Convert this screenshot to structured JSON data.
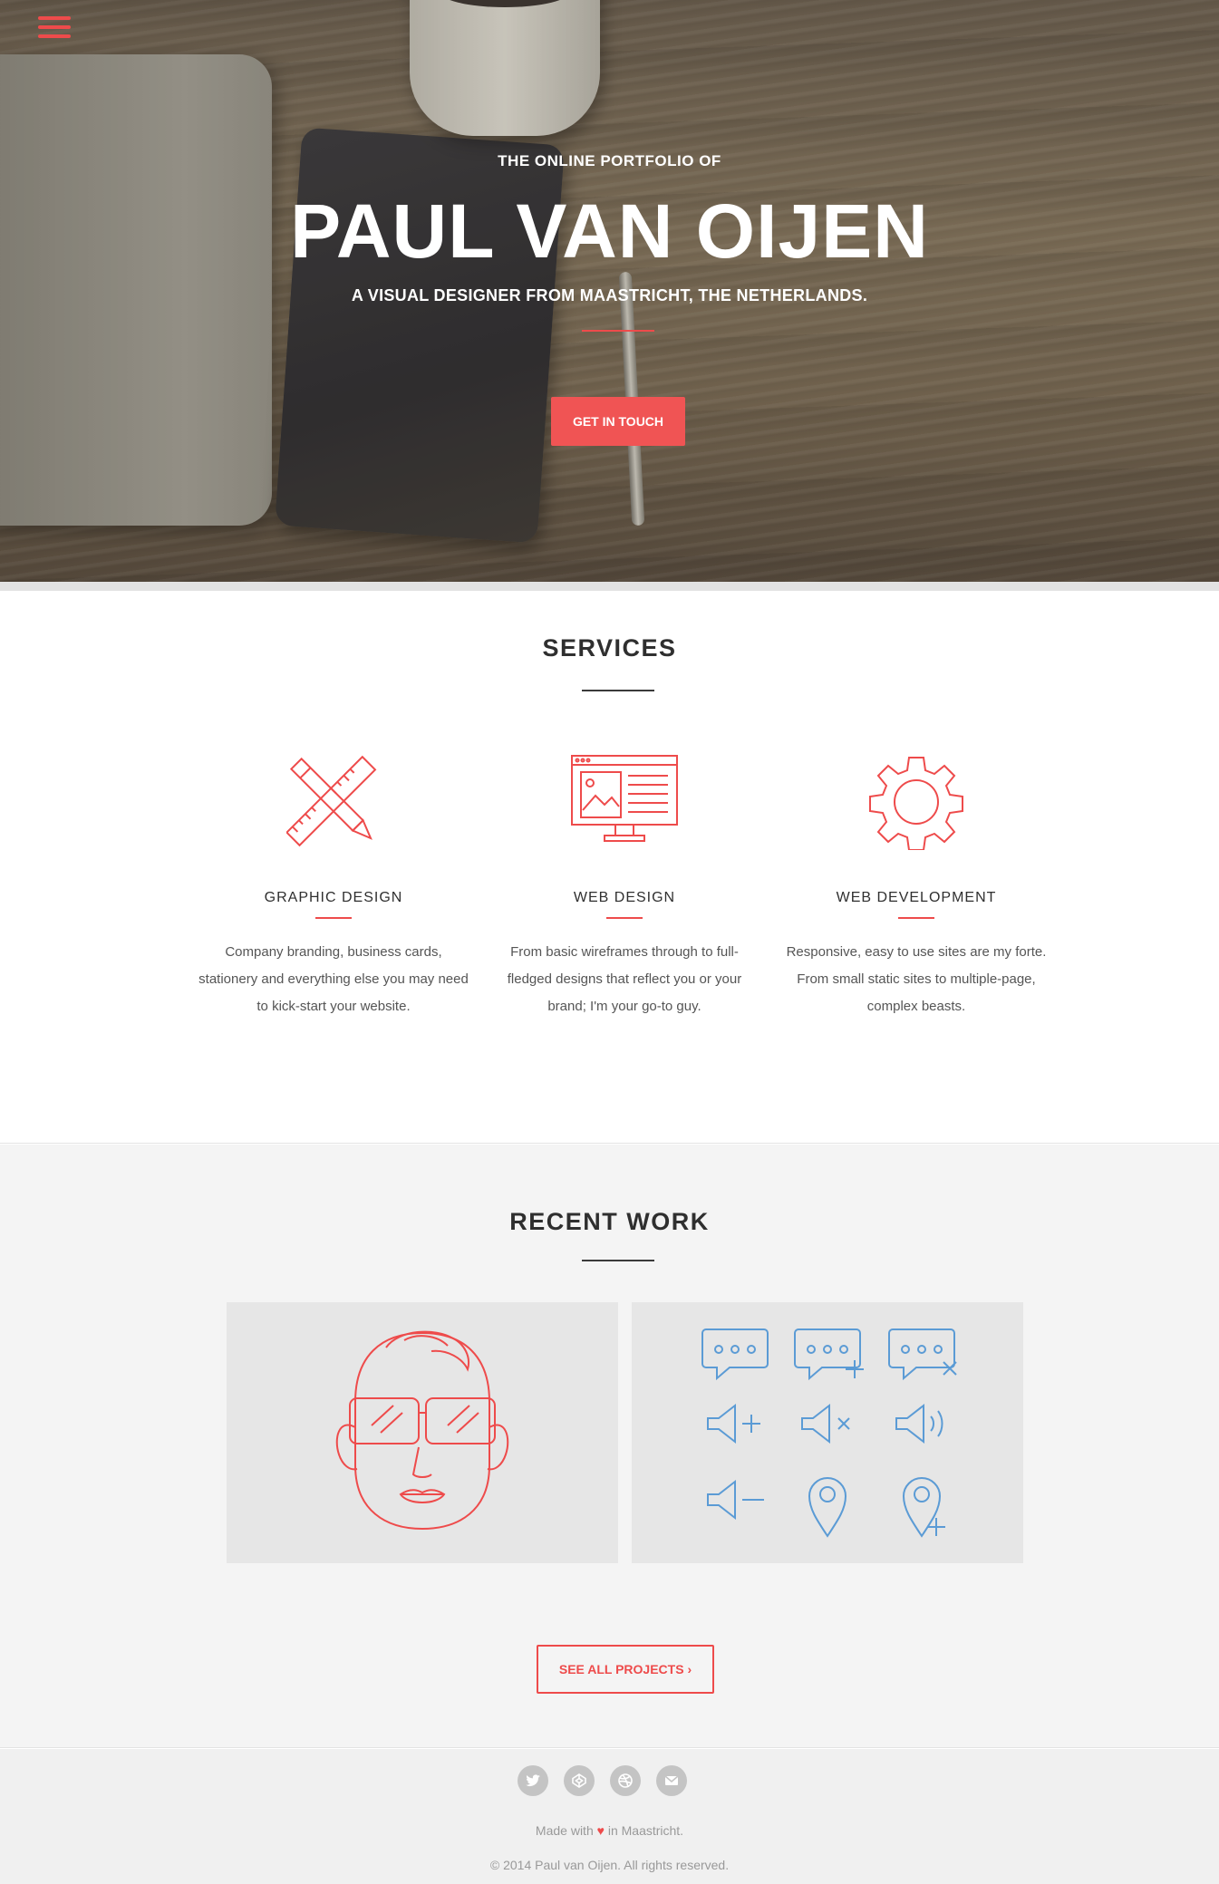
{
  "hero": {
    "kicker": "THE ONLINE PORTFOLIO OF",
    "title": "PAUL VAN OIJEN",
    "subtitle": "A VISUAL DESIGNER FROM MAASTRICHT, THE NETHERLANDS.",
    "cta_label": "GET IN TOUCH"
  },
  "menu": {
    "icon": "hamburger-menu-icon"
  },
  "services": {
    "title": "SERVICES",
    "items": [
      {
        "icon": "pencil-ruler-icon",
        "title": "GRAPHIC DESIGN",
        "text": "Company branding, business cards, stationery and everything else you may need to kick-start your website."
      },
      {
        "icon": "browser-window-icon",
        "title": "WEB DESIGN",
        "text": "From basic wireframes through to full-fledged designs that reflect you or your brand; I'm your go-to guy."
      },
      {
        "icon": "gear-icon",
        "title": "WEB DEVELOPMENT",
        "text": "Responsive, easy to use sites are my forte. From small static sites to multiple-page, complex beasts."
      }
    ]
  },
  "work": {
    "title": "RECENT WORK",
    "cards": [
      "portrait-illustration",
      "icon-set"
    ],
    "see_all_label": "SEE ALL PROJECTS"
  },
  "footer": {
    "social": [
      "twitter-icon",
      "codepen-icon",
      "dribbble-icon",
      "email-icon"
    ],
    "made_prefix": "Made with",
    "made_suffix": "in Maastricht.",
    "copyright": "© 2014 Paul van Oijen. All rights reserved."
  },
  "colors": {
    "accent": "#ee4b4b",
    "icon_blue": "#5b9bd5",
    "footer_bg": "#f0f0f0"
  }
}
